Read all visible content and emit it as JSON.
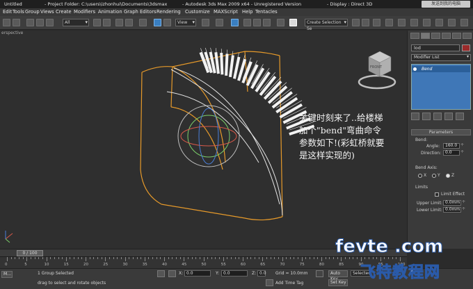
{
  "titlebar": {
    "doc": "Untitled",
    "project": "- Project Folder: C:\\users\\izhonhui\\Documents\\3dsmax",
    "app": "-  Autodesk 3ds Max  2009 x64  -  Unregistered Version",
    "display": "- Display : Direct 3D",
    "badge": "发送到我的电脑"
  },
  "menu": [
    "Edit",
    "Tools",
    "Group",
    "Views",
    "Create",
    "Modifiers",
    "Animation",
    "Graph Editors",
    "Rendering",
    "Customize",
    "MAXScript",
    "Help",
    "Tentacles"
  ],
  "toolbar": {
    "selection_filter": "All",
    "ref_coord": "View",
    "named_selection": "Create Selection Se"
  },
  "viewport": {
    "label": "erspective",
    "annotation": {
      "line1": "关键时刻来了..给楼梯",
      "line2": "加个\"bend\"弯曲命令",
      "line3": "参数如下!(彩虹桥就要",
      "line4": "是这样实现的)"
    },
    "viewcube_face": "FRONT",
    "colors": {
      "gizmo": "#e79a2a",
      "stairs": "#f2f2f2"
    }
  },
  "command_panel": {
    "object_name": "lod",
    "modifier_list": "Modifier List",
    "stack_item": "Bend",
    "rollout": "Parameters",
    "bend_group": "Bend:",
    "angle_label": "Angle:",
    "angle_value": "160.0",
    "direction_label": "Direction:",
    "direction_value": "0.0",
    "axis_group": "Bend Axis:",
    "axis_x": "X",
    "axis_y": "Y",
    "axis_z": "Z",
    "limits_group": "Limits",
    "limit_effect": "Limit Effect",
    "upper_label": "Upper Limit:",
    "upper_value": "0.0mm",
    "lower_label": "Lower Limit:",
    "lower_value": "0.0mm"
  },
  "timeline": {
    "slider": "0 / 100",
    "ticks": [
      "0",
      "5",
      "10",
      "15",
      "20",
      "25",
      "30",
      "35",
      "40",
      "45",
      "50",
      "55",
      "60",
      "65",
      "70",
      "75",
      "80",
      "85",
      "90",
      "95",
      "100"
    ]
  },
  "status": {
    "taskbar_label": "M...",
    "selected": "1 Group Selected",
    "prompt": "drag to select and rotate objects",
    "x_label": "X:",
    "x_value": "0.0",
    "y_label": "Y:",
    "y_value": "0.0",
    "z_label": "Z:",
    "z_value": "0.0",
    "grid": "Grid = 10.0mm",
    "add_time_tag": "Add Time Tag",
    "auto_key": "Auto Key",
    "set_key": "Set Key",
    "selected_btn": "Selected"
  },
  "watermark": {
    "line1": "fevte .com",
    "line2": "飞特教程网"
  }
}
